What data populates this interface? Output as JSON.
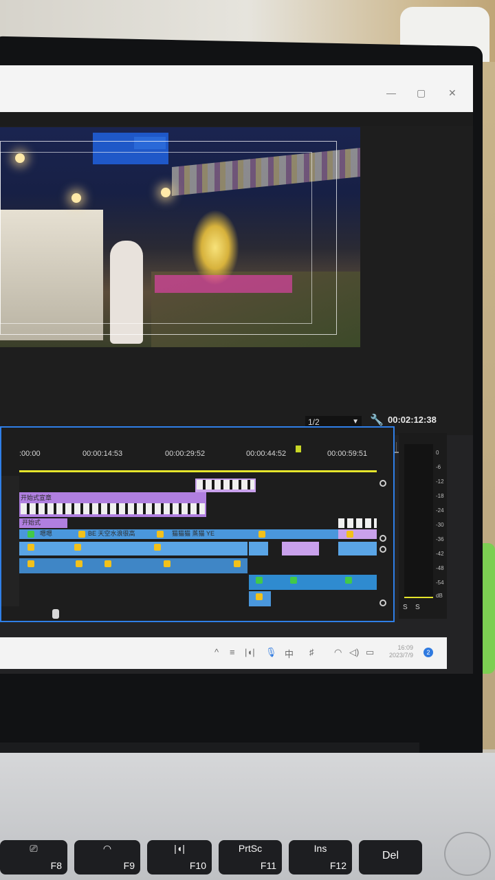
{
  "program_monitor": {
    "resolution": "1/2",
    "timecode": "00:02:12:38"
  },
  "transport": {
    "mark_in": "{",
    "mark_out": "}",
    "go_to_in": "|←",
    "step_back": "◂|",
    "play": "▶",
    "step_forward": "|▸",
    "go_to_out": "→|",
    "add": "+"
  },
  "timeline": {
    "ruler": [
      ":00:00",
      "00:00:14:53",
      "00:00:29:52",
      "00:00:44:52",
      "00:00:59:51"
    ],
    "clips": {
      "title_clip": "开始式宣章",
      "v1_label": "开始式",
      "a1_label": "嗯嗯",
      "a1_clip2": "BE 天空水浪很高",
      "a1_clip3": "猫猫猫 蒸猫 YE"
    }
  },
  "audio_meter": {
    "db_scale": [
      "0",
      "-6",
      "-12",
      "-18",
      "-24",
      "-30",
      "-36",
      "-42",
      "-48",
      "-54",
      "dB"
    ],
    "solo_left": "S",
    "solo_right": "S"
  },
  "taskbar": {
    "chevron": "^",
    "ime": "中",
    "time": "16:09",
    "date": "2023/7/9",
    "notification_count": "2"
  },
  "keyboard": {
    "f8": "F8",
    "f9": "F9",
    "f10": "F10",
    "f11": "F11",
    "f12": "F12",
    "prtsc": "PrtSc",
    "ins": "Ins",
    "del": "Del"
  }
}
